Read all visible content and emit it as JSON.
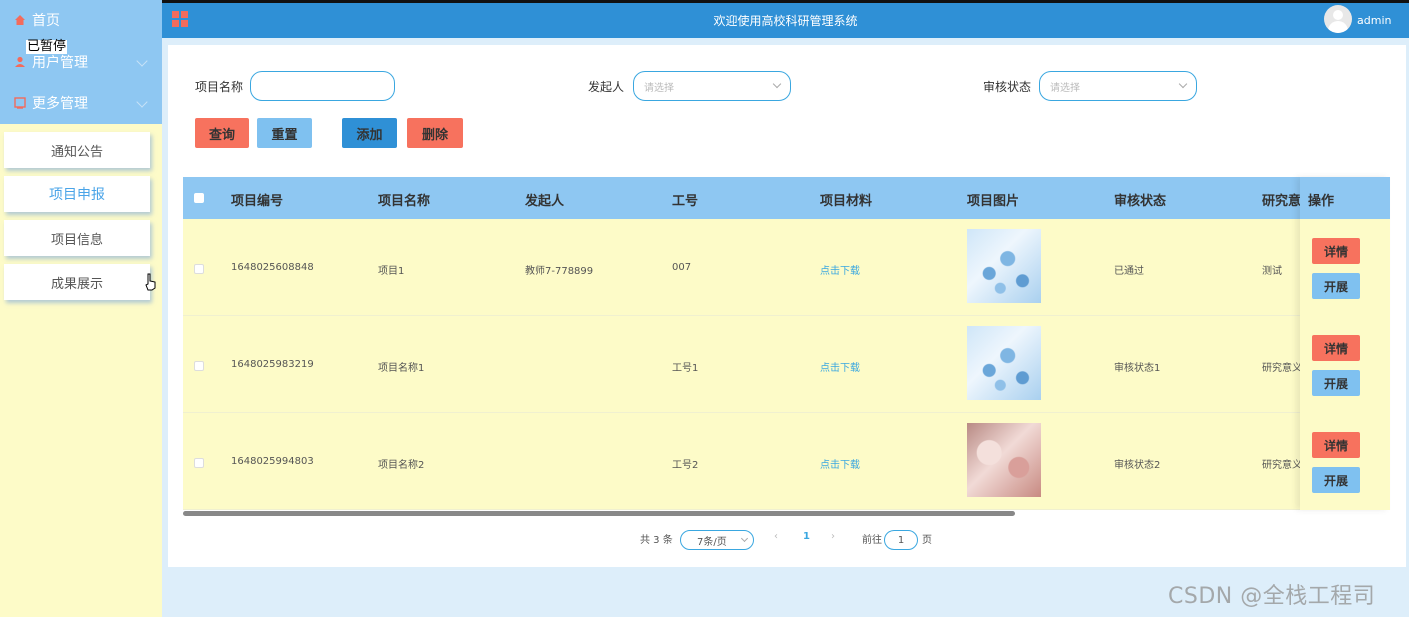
{
  "sidebar": {
    "menu": [
      {
        "label": "首页",
        "icon": "home-icon"
      },
      {
        "label": "用户管理",
        "icon": "user-icon"
      },
      {
        "label": "更多管理",
        "icon": "menu-icon"
      }
    ],
    "paused_overlay": "已暂停",
    "sub_items": [
      {
        "label": "通知公告"
      },
      {
        "label": "项目申报"
      },
      {
        "label": "项目信息"
      },
      {
        "label": "成果展示"
      }
    ],
    "active_sub_item": "项目申报"
  },
  "header": {
    "title": "欢迎使用高校科研管理系统",
    "username": "admin"
  },
  "filters": {
    "name_label": "项目名称",
    "name_value": "",
    "initiator_label": "发起人",
    "initiator_placeholder": "请选择",
    "status_label": "审核状态",
    "status_placeholder": "请选择"
  },
  "actions": {
    "query": "查询",
    "reset": "重置",
    "add": "添加",
    "delete": "删除"
  },
  "table": {
    "columns": [
      "项目编号",
      "项目名称",
      "发起人",
      "工号",
      "项目材料",
      "项目图片",
      "审核状态",
      "研究意",
      "操作"
    ],
    "rows": [
      {
        "id": "1648025608848",
        "name": "项目1",
        "initiator": "教师7-778899",
        "job_no": "007",
        "material": "点击下载",
        "image": "blue",
        "status": "已通过",
        "research": "测试"
      },
      {
        "id": "1648025983219",
        "name": "项目名称1",
        "initiator": "",
        "job_no": "工号1",
        "material": "点击下载",
        "image": "blue",
        "status": "审核状态1",
        "research": "研究意义"
      },
      {
        "id": "1648025994803",
        "name": "项目名称2",
        "initiator": "",
        "job_no": "工号2",
        "material": "点击下载",
        "image": "pink",
        "status": "审核状态2",
        "research": "研究意义"
      }
    ],
    "row_actions": {
      "detail": "详情",
      "expand": "开展"
    }
  },
  "pagination": {
    "total": "共 3 条",
    "page_size": "7条/页",
    "prev": "‹",
    "current_page": "1",
    "next": "›",
    "goto_prefix": "前往",
    "goto_value": "1",
    "goto_suffix": "页"
  },
  "watermark": "CSDN @全栈工程司",
  "colors": {
    "header_bg": "#2f90d6",
    "sidebar_top": "#8ec7f2",
    "sidebar_bg": "#fdfbc8",
    "button_red": "#f7725e",
    "button_blue": "#7fc1f0",
    "accent": "#3aa7e0"
  }
}
